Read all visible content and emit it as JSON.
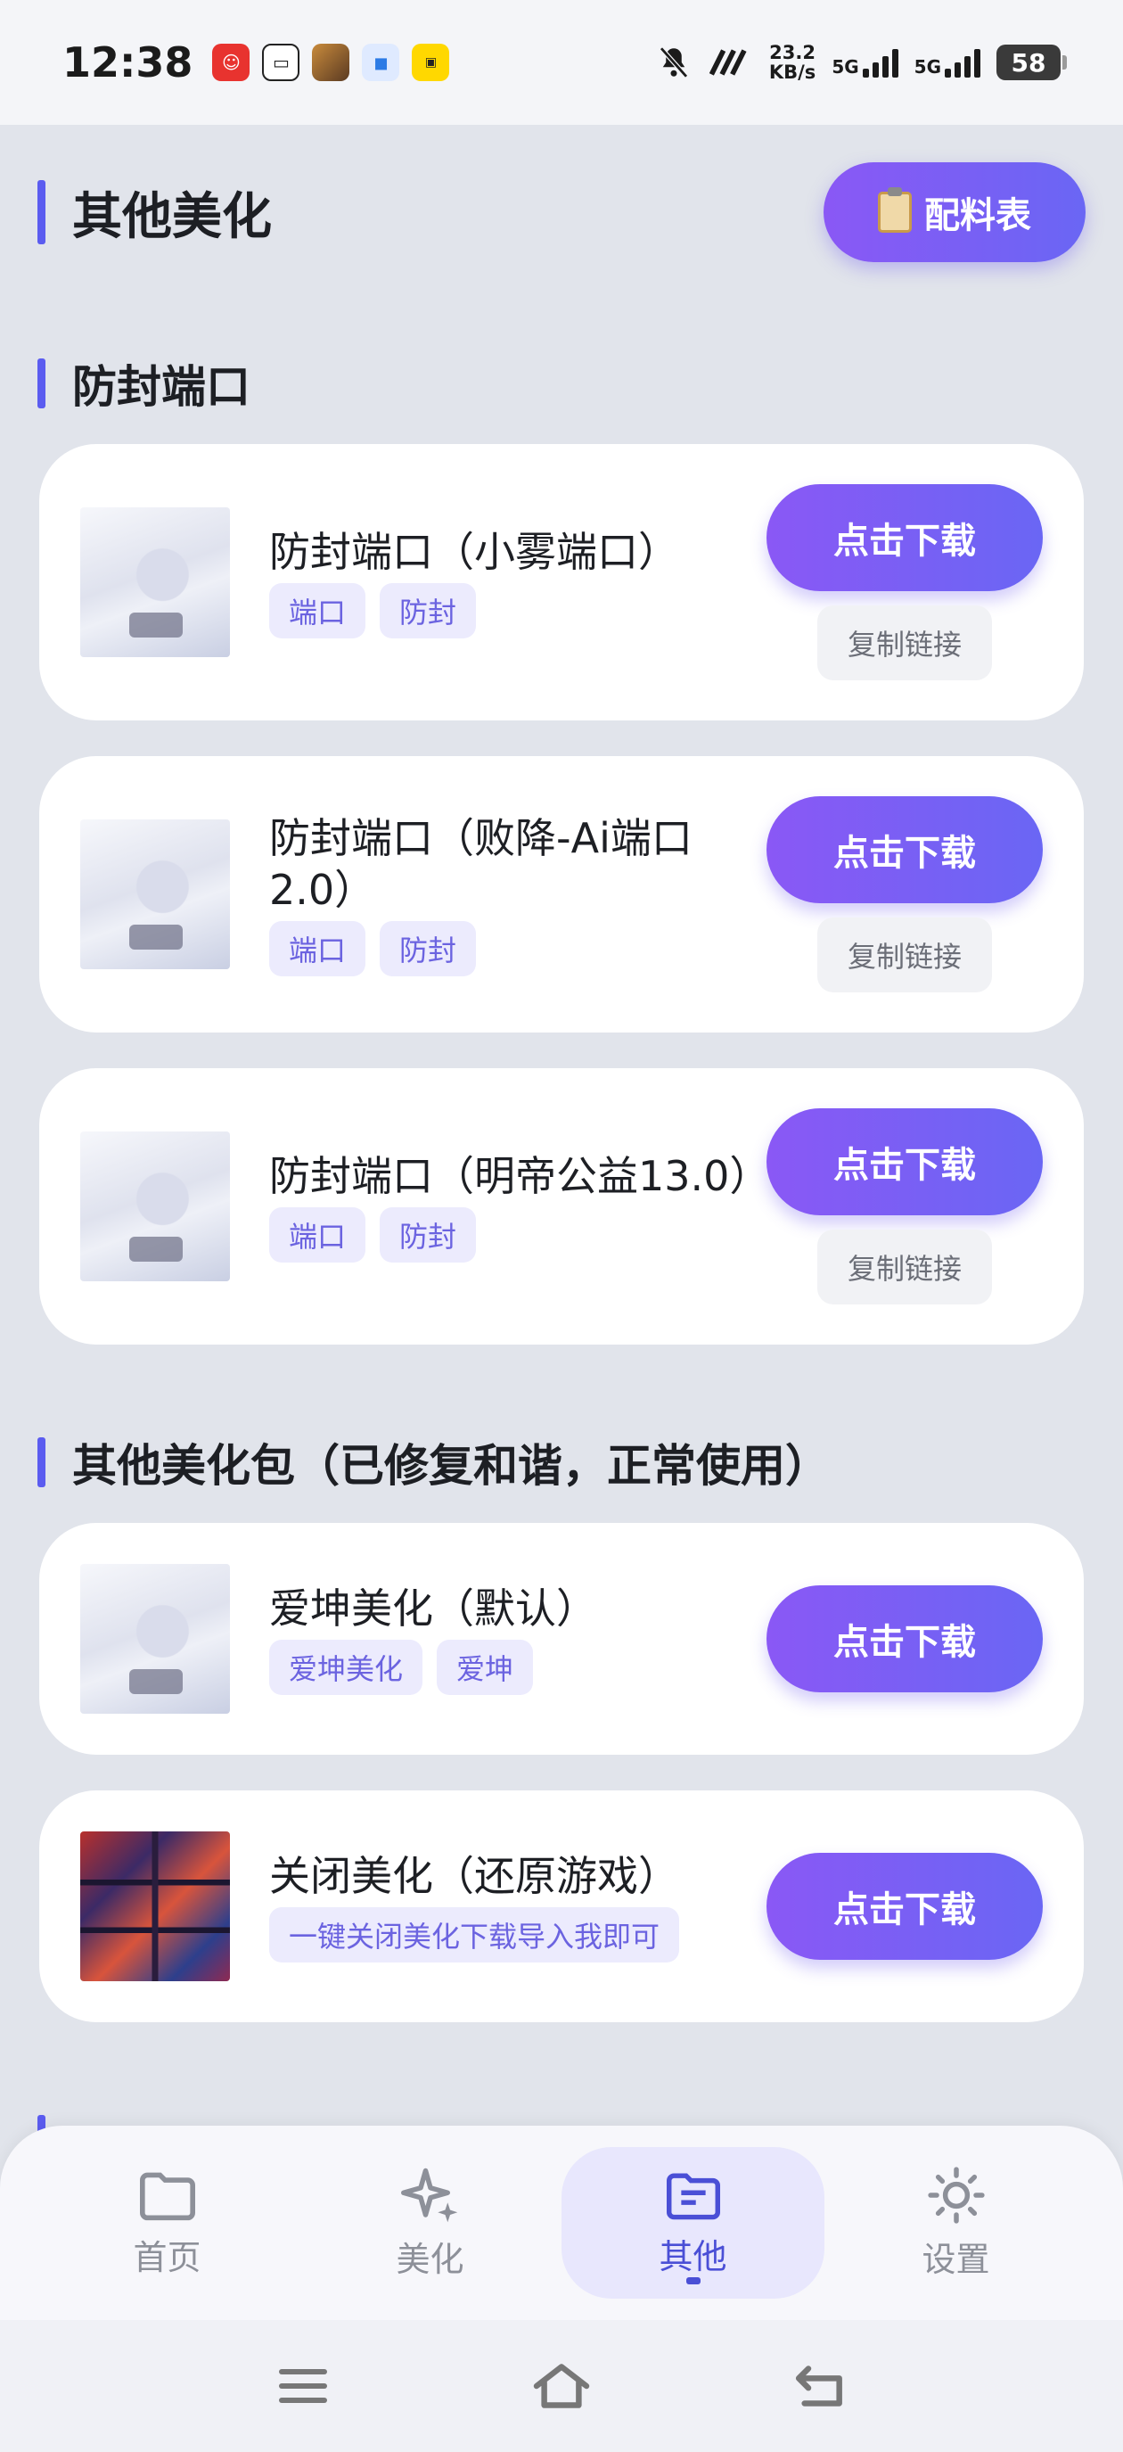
{
  "status_bar": {
    "time": "12:38",
    "net_speed_value": "23.2",
    "net_speed_unit": "KB/s",
    "net1": "5G",
    "net2": "5G",
    "battery": "58",
    "notification_icons": [
      "app-icon-red",
      "app-icon-chat",
      "app-icon-game",
      "app-icon-blue",
      "app-icon-yellow"
    ]
  },
  "header": {
    "title": "其他美化",
    "materials_label": "配料表"
  },
  "sections": [
    {
      "title": "防封端口",
      "items": [
        {
          "title": "防封端口（小雾端口）",
          "tags": [
            "端口",
            "防封"
          ],
          "download_label": "点击下载",
          "copy_label": "复制链接"
        },
        {
          "title": "防封端口（败降-Ai端口2.0）",
          "tags": [
            "端口",
            "防封"
          ],
          "download_label": "点击下载",
          "copy_label": "复制链接"
        },
        {
          "title": "防封端口（明帝公益13.0）",
          "tags": [
            "端口",
            "防封"
          ],
          "download_label": "点击下载",
          "copy_label": "复制链接"
        }
      ]
    },
    {
      "title": "其他美化包（已修复和谐，正常使用）",
      "items": [
        {
          "title": "爱坤美化（默认）",
          "tags": [
            "爱坤美化",
            "爱坤"
          ],
          "download_label": "点击下载"
        },
        {
          "title": "关闭美化（还原游戏）",
          "tags": [
            "一键关闭美化下载导入我即可"
          ],
          "download_label": "点击下载"
        }
      ]
    }
  ],
  "bottom_nav": [
    {
      "label": "首页",
      "icon": "folder-icon"
    },
    {
      "label": "美化",
      "icon": "sparkle-icon"
    },
    {
      "label": "其他",
      "icon": "file-folder-icon",
      "active": true
    },
    {
      "label": "设置",
      "icon": "sun-gear-icon"
    }
  ],
  "colors": {
    "accent": "#5b5cf0",
    "button_gradient_start": "#8a58f5",
    "button_gradient_end": "#6a66f4",
    "page_bg": "#e1e4eb"
  }
}
